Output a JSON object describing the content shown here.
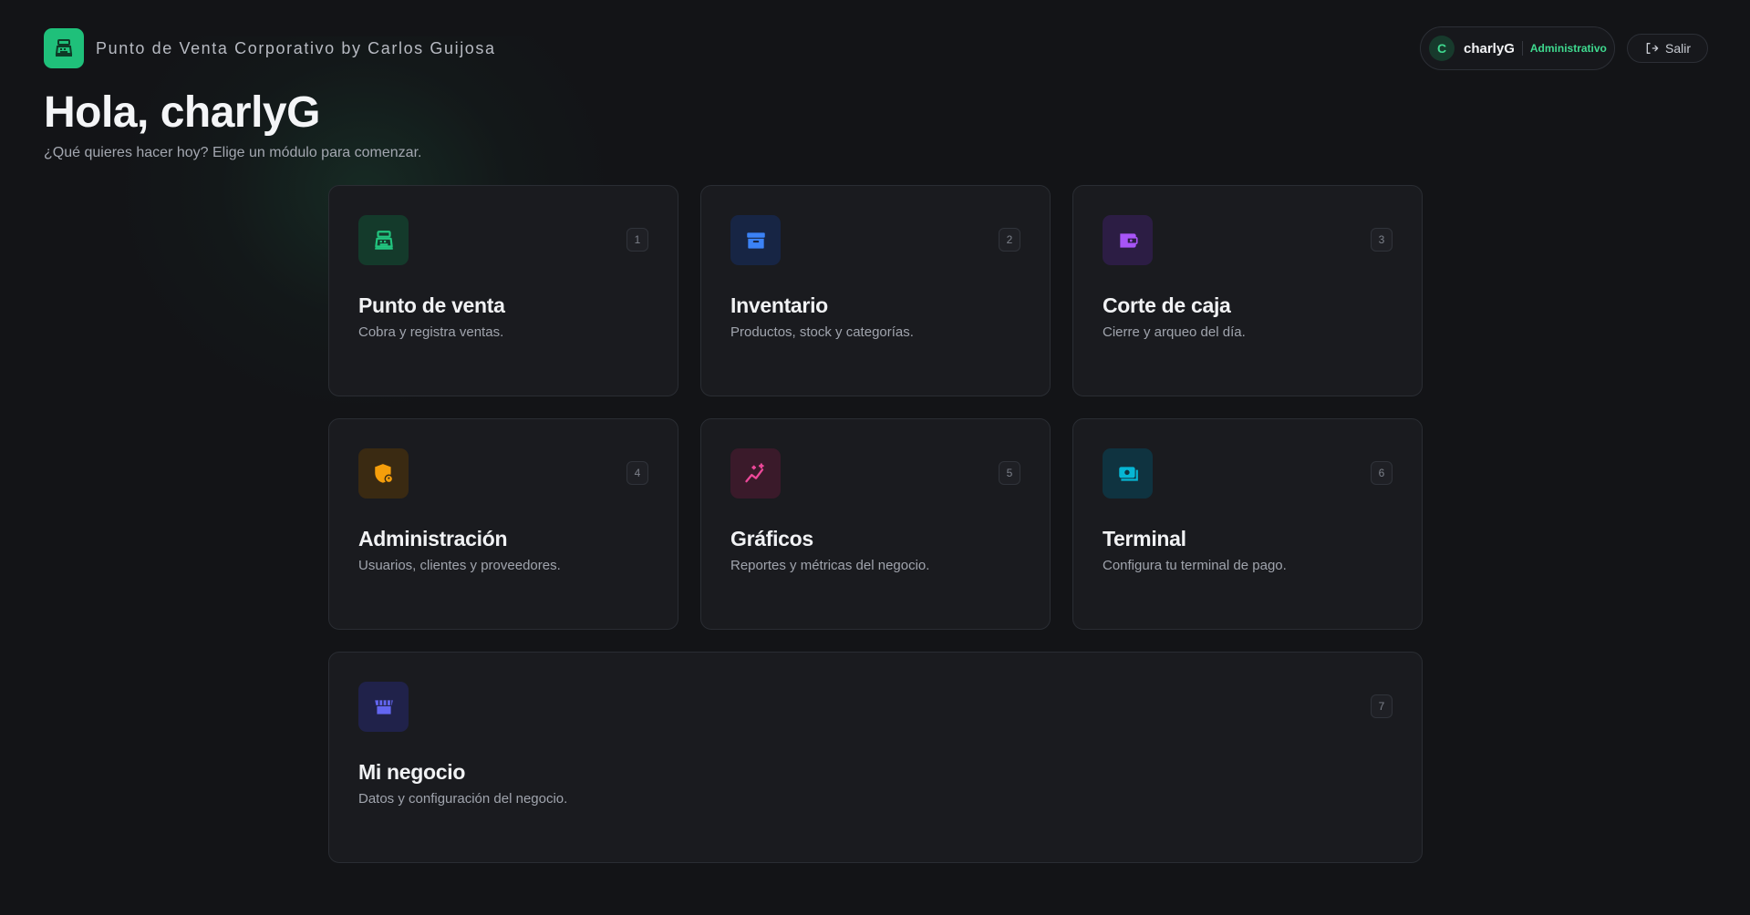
{
  "header": {
    "app_title": "Punto de Venta Corporativo by Carlos Guijosa",
    "user": {
      "initial": "C",
      "name": "charlyG",
      "role": "Administrativo"
    },
    "logout_label": "Salir"
  },
  "greeting": {
    "title": "Hola, charlyG",
    "subtitle": "¿Qué quieres hacer hoy? Elige un módulo para comenzar."
  },
  "modules": [
    {
      "title": "Punto de venta",
      "description": "Cobra y registra ventas.",
      "key": "1",
      "icon": "cash-register-icon",
      "color": "#22c57f",
      "bg": "#143a2b"
    },
    {
      "title": "Inventario",
      "description": "Productos, stock y categorías.",
      "key": "2",
      "icon": "archive-box-icon",
      "color": "#3b82f6",
      "bg": "#172544"
    },
    {
      "title": "Corte de caja",
      "description": "Cierre y arqueo del día.",
      "key": "3",
      "icon": "wallet-icon",
      "color": "#a855f7",
      "bg": "#2c1d44"
    },
    {
      "title": "Administración",
      "description": "Usuarios, clientes y proveedores.",
      "key": "4",
      "icon": "shield-user-icon",
      "color": "#f59e0b",
      "bg": "#3a2a12"
    },
    {
      "title": "Gráficos",
      "description": "Reportes y métricas del negocio.",
      "key": "5",
      "icon": "chart-sparkle-icon",
      "color": "#ec4899",
      "bg": "#3a1a2a"
    },
    {
      "title": "Terminal",
      "description": "Configura tu terminal de pago.",
      "key": "6",
      "icon": "payment-terminal-icon",
      "color": "#06b6d4",
      "bg": "#0f3340"
    },
    {
      "title": "Mi negocio",
      "description": "Datos y configuración del negocio.",
      "key": "7",
      "icon": "store-icon",
      "color": "#6366f1",
      "bg": "#20224a"
    }
  ]
}
